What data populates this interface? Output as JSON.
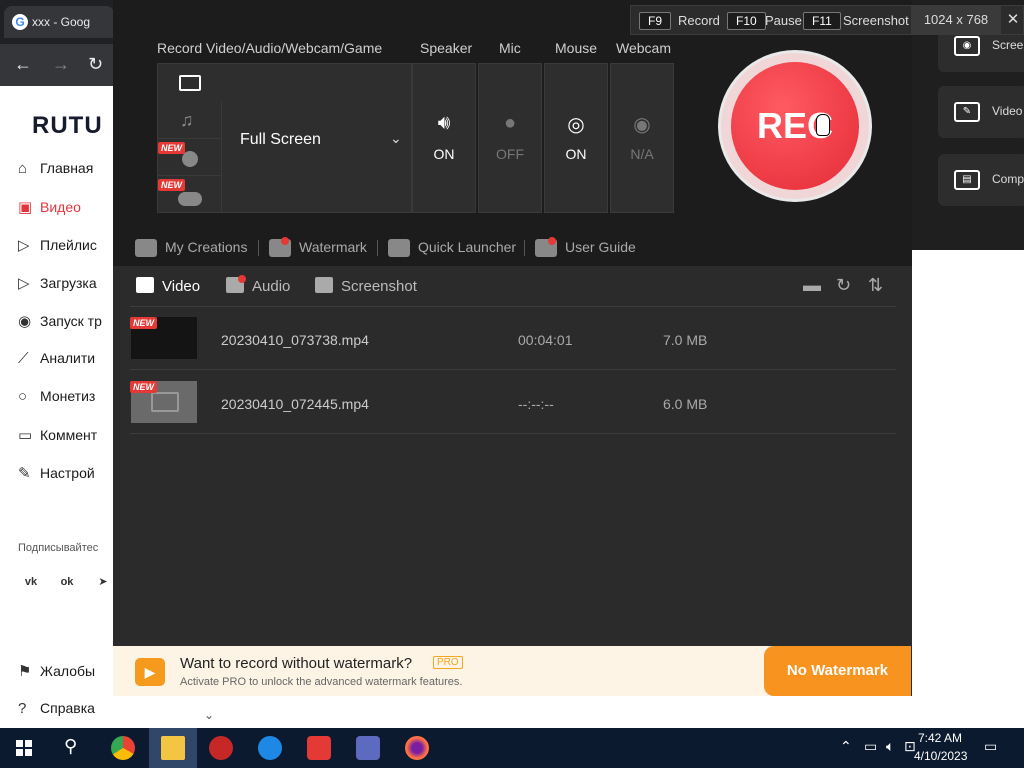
{
  "browser": {
    "tab_title": "xxx - Goog",
    "logo": "RUTU",
    "nav": [
      {
        "label": "Главная",
        "icon": "home-icon"
      },
      {
        "label": "Видео",
        "icon": "video-icon",
        "active": true
      },
      {
        "label": "Плейлис",
        "icon": "playlist-icon"
      },
      {
        "label": "Загрузка",
        "icon": "upload-icon"
      },
      {
        "label": "Запуск тр",
        "icon": "broadcast-icon"
      },
      {
        "label": "Аналити",
        "icon": "analytics-icon"
      },
      {
        "label": "Монетиз",
        "icon": "money-icon"
      },
      {
        "label": "Коммент",
        "icon": "comment-icon"
      },
      {
        "label": "Настрой",
        "icon": "settings-icon"
      },
      {
        "label": "Жалобы",
        "icon": "flag-icon"
      },
      {
        "label": "Справка",
        "icon": "help-icon"
      }
    ],
    "subscribe": "Подписывайтес",
    "social": [
      "vk",
      "ok",
      "telegram"
    ]
  },
  "right_panel": {
    "items": [
      {
        "label": "Screen",
        "icon": "camera-icon"
      },
      {
        "label": "Video",
        "icon": "edit-icon"
      },
      {
        "label": "Comp",
        "icon": "compress-icon"
      }
    ]
  },
  "hotkeys": {
    "record_key": "F9",
    "record_label": "Record",
    "pause_key": "F10",
    "pause_label": "Pause",
    "screenshot_key": "F11",
    "screenshot_label": "Screenshot",
    "resolution": "1024 x 768"
  },
  "recorder": {
    "mode_header": "Record Video/Audio/Webcam/Game",
    "mode_selected": "Full Screen",
    "new_badge": "NEW",
    "devices": [
      {
        "name": "Speaker",
        "status": "ON",
        "icon": "speaker-icon"
      },
      {
        "name": "Mic",
        "status": "OFF",
        "icon": "mic-icon"
      },
      {
        "name": "Mouse",
        "status": "ON",
        "icon": "mouse-icon"
      },
      {
        "name": "Webcam",
        "status": "N/A",
        "icon": "webcam-icon"
      }
    ],
    "rec_label": "REC",
    "links": [
      "My Creations",
      "Watermark",
      "Quick Launcher",
      "User Guide"
    ]
  },
  "library": {
    "tabs": [
      "Video",
      "Audio",
      "Screenshot"
    ],
    "files": [
      {
        "name": "20230410_073738.mp4",
        "duration": "00:04:01",
        "size": "7.0 MB"
      },
      {
        "name": "20230410_072445.mp4",
        "duration": "--:--:--",
        "size": "6.0 MB"
      }
    ]
  },
  "promo": {
    "title": "Want to record without watermark?",
    "badge": "PRO",
    "subtitle": "Activate PRO to unlock the advanced watermark features.",
    "button": "No Watermark"
  },
  "taskbar": {
    "time": "7:42 AM",
    "date": "4/10/2023"
  }
}
